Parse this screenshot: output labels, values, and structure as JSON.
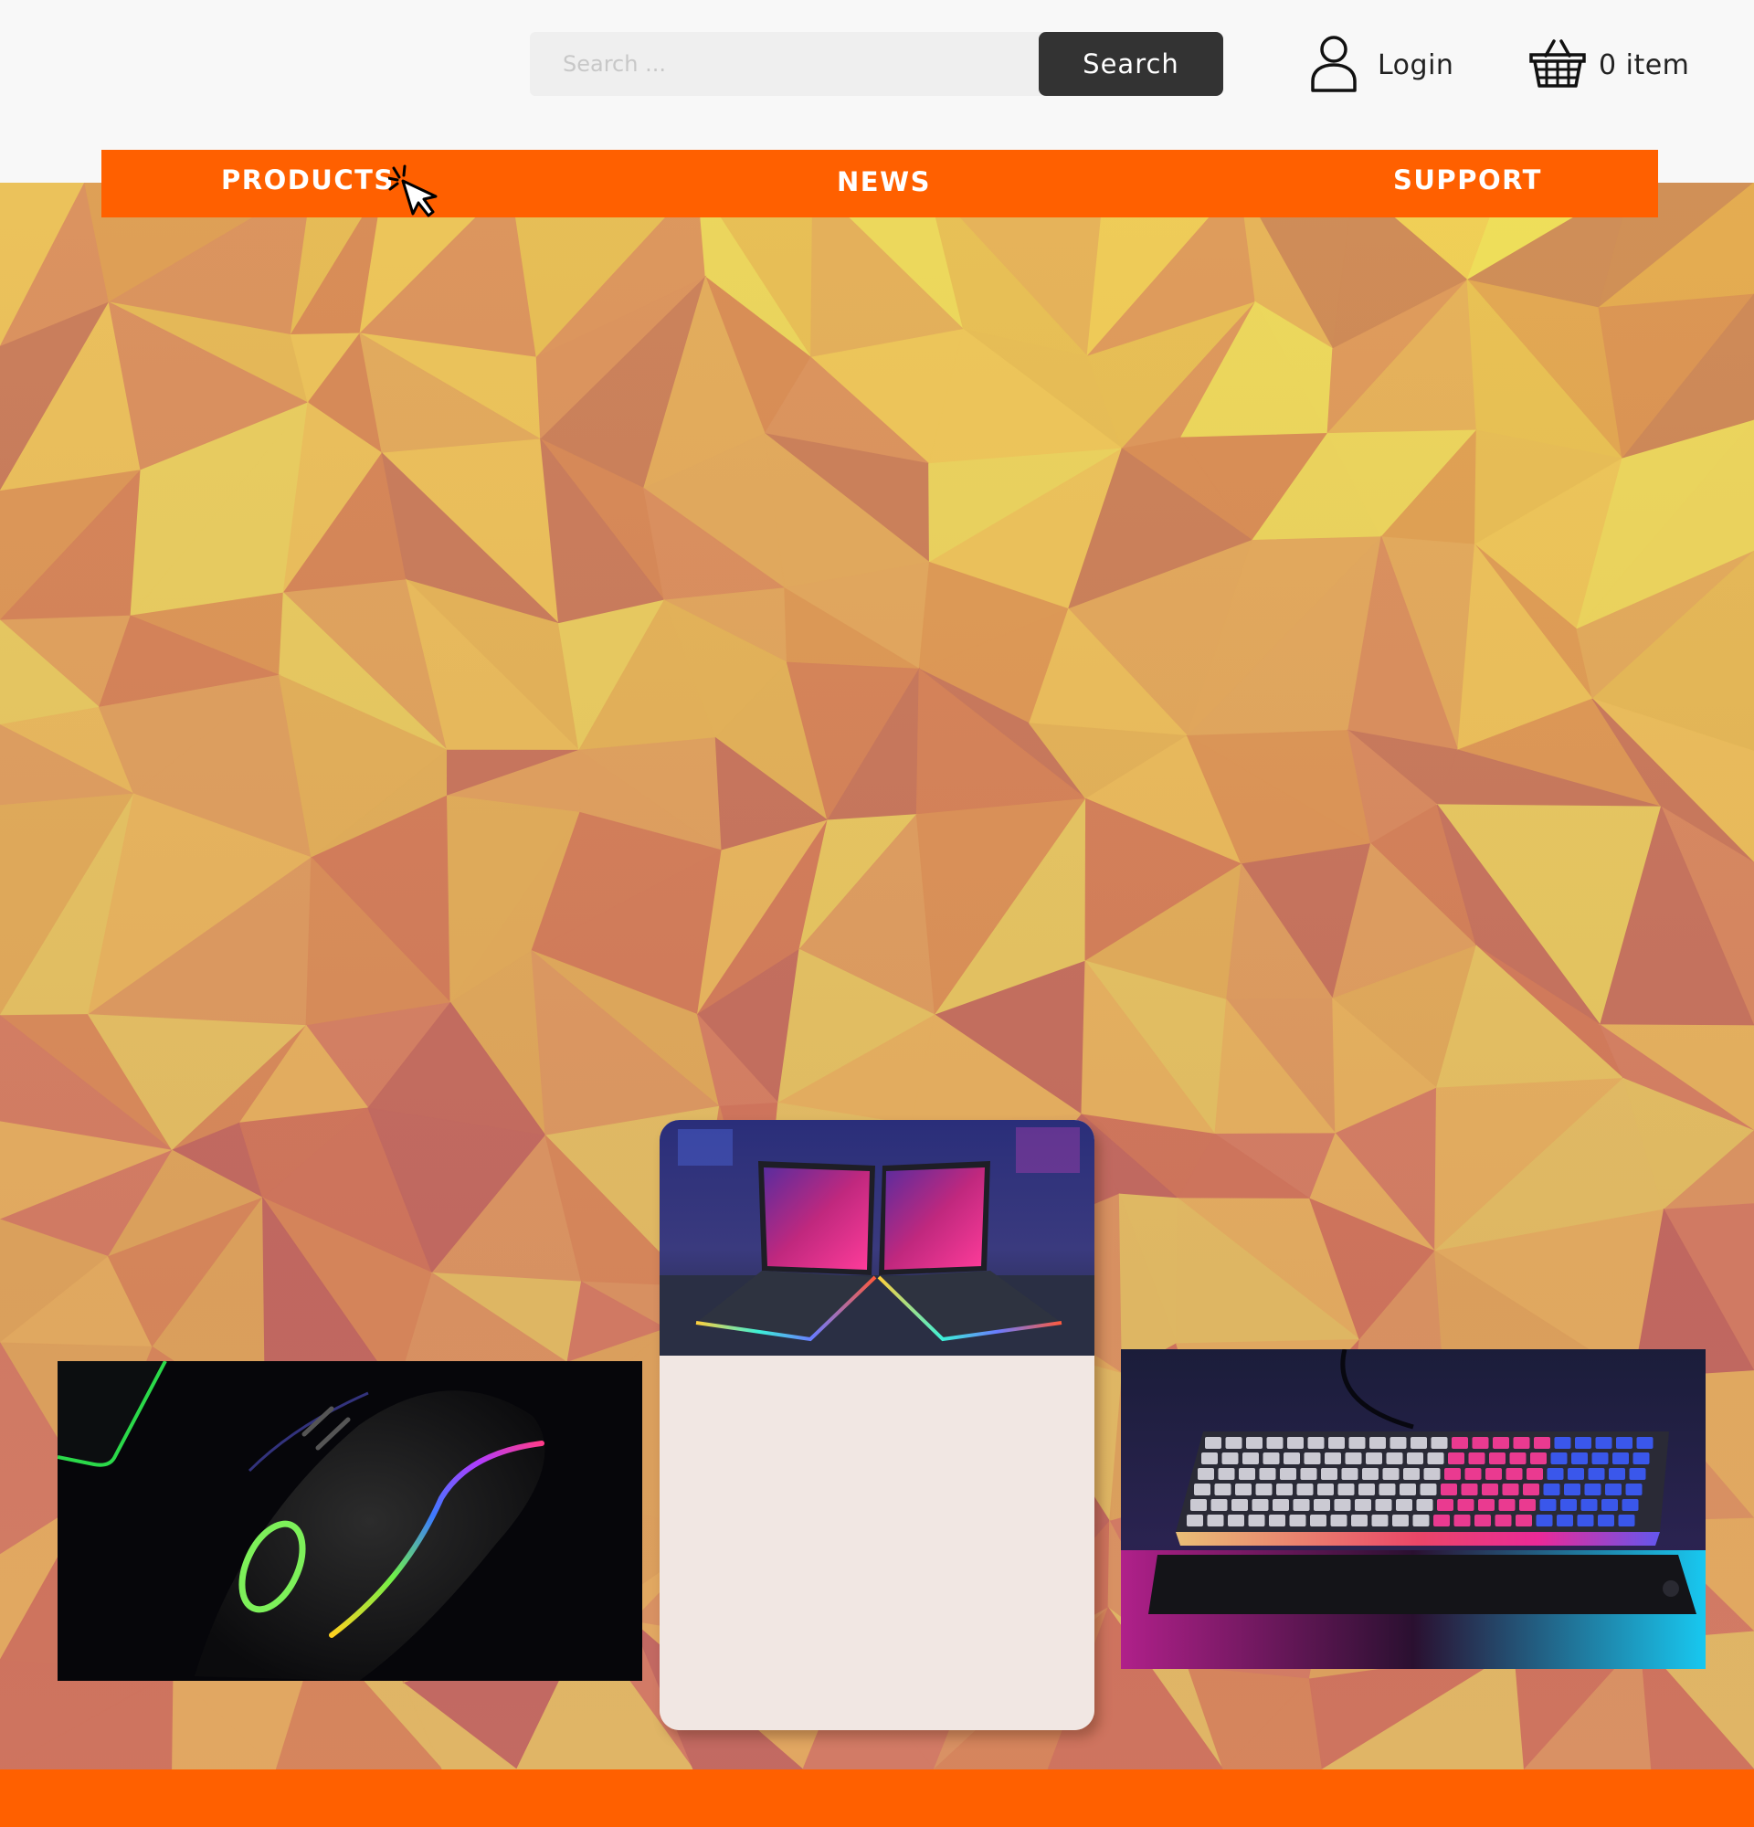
{
  "header": {
    "search": {
      "placeholder": "Search ...",
      "value": "",
      "button_label": "Search"
    },
    "login": {
      "label": "Login",
      "icon": "user-icon"
    },
    "cart": {
      "label": "0 item",
      "icon": "basket-icon"
    }
  },
  "nav": {
    "items": [
      {
        "label": "PRODUCTS"
      },
      {
        "label": "NEWS"
      },
      {
        "label": "SUPPORT"
      }
    ],
    "hover_icon": "click-cursor-icon"
  },
  "products": {
    "cards": [
      {
        "name": "gaming-mouse",
        "image": "rgb gaming mouse photo"
      },
      {
        "name": "gaming-laptops",
        "image": "rog gaming laptops photo"
      },
      {
        "name": "gaming-keyboard",
        "image": "rgb gaming keyboard photo"
      }
    ]
  },
  "colors": {
    "accent": "#ff6000",
    "search_button": "#333333",
    "header_bg": "#f8f8f8",
    "hero_base": "#dd8e5a"
  }
}
